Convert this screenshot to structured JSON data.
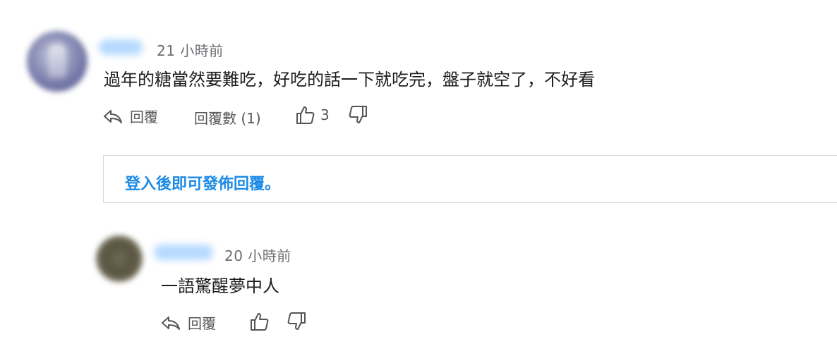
{
  "comments": [
    {
      "time": "21 小時前",
      "text": "過年的糖當然要難吃，好吃的話一下就吃完，盤子就空了，不好看",
      "actions": {
        "reply_label": "回覆",
        "reply_count_label": "回覆數 (1)",
        "likes": "3"
      }
    },
    {
      "time": "20 小時前",
      "text": "一語驚醒夢中人",
      "actions": {
        "reply_label": "回覆"
      }
    }
  ],
  "login_prompt": "登入後即可發佈回覆。",
  "icons": {
    "reply": "reply-arrow-icon",
    "like": "thumbs-up-icon",
    "dislike": "thumbs-down-icon"
  },
  "colors": {
    "link_blue": "#1a8ae6",
    "action_gray": "#555555",
    "time_gray": "#6e6e73"
  }
}
